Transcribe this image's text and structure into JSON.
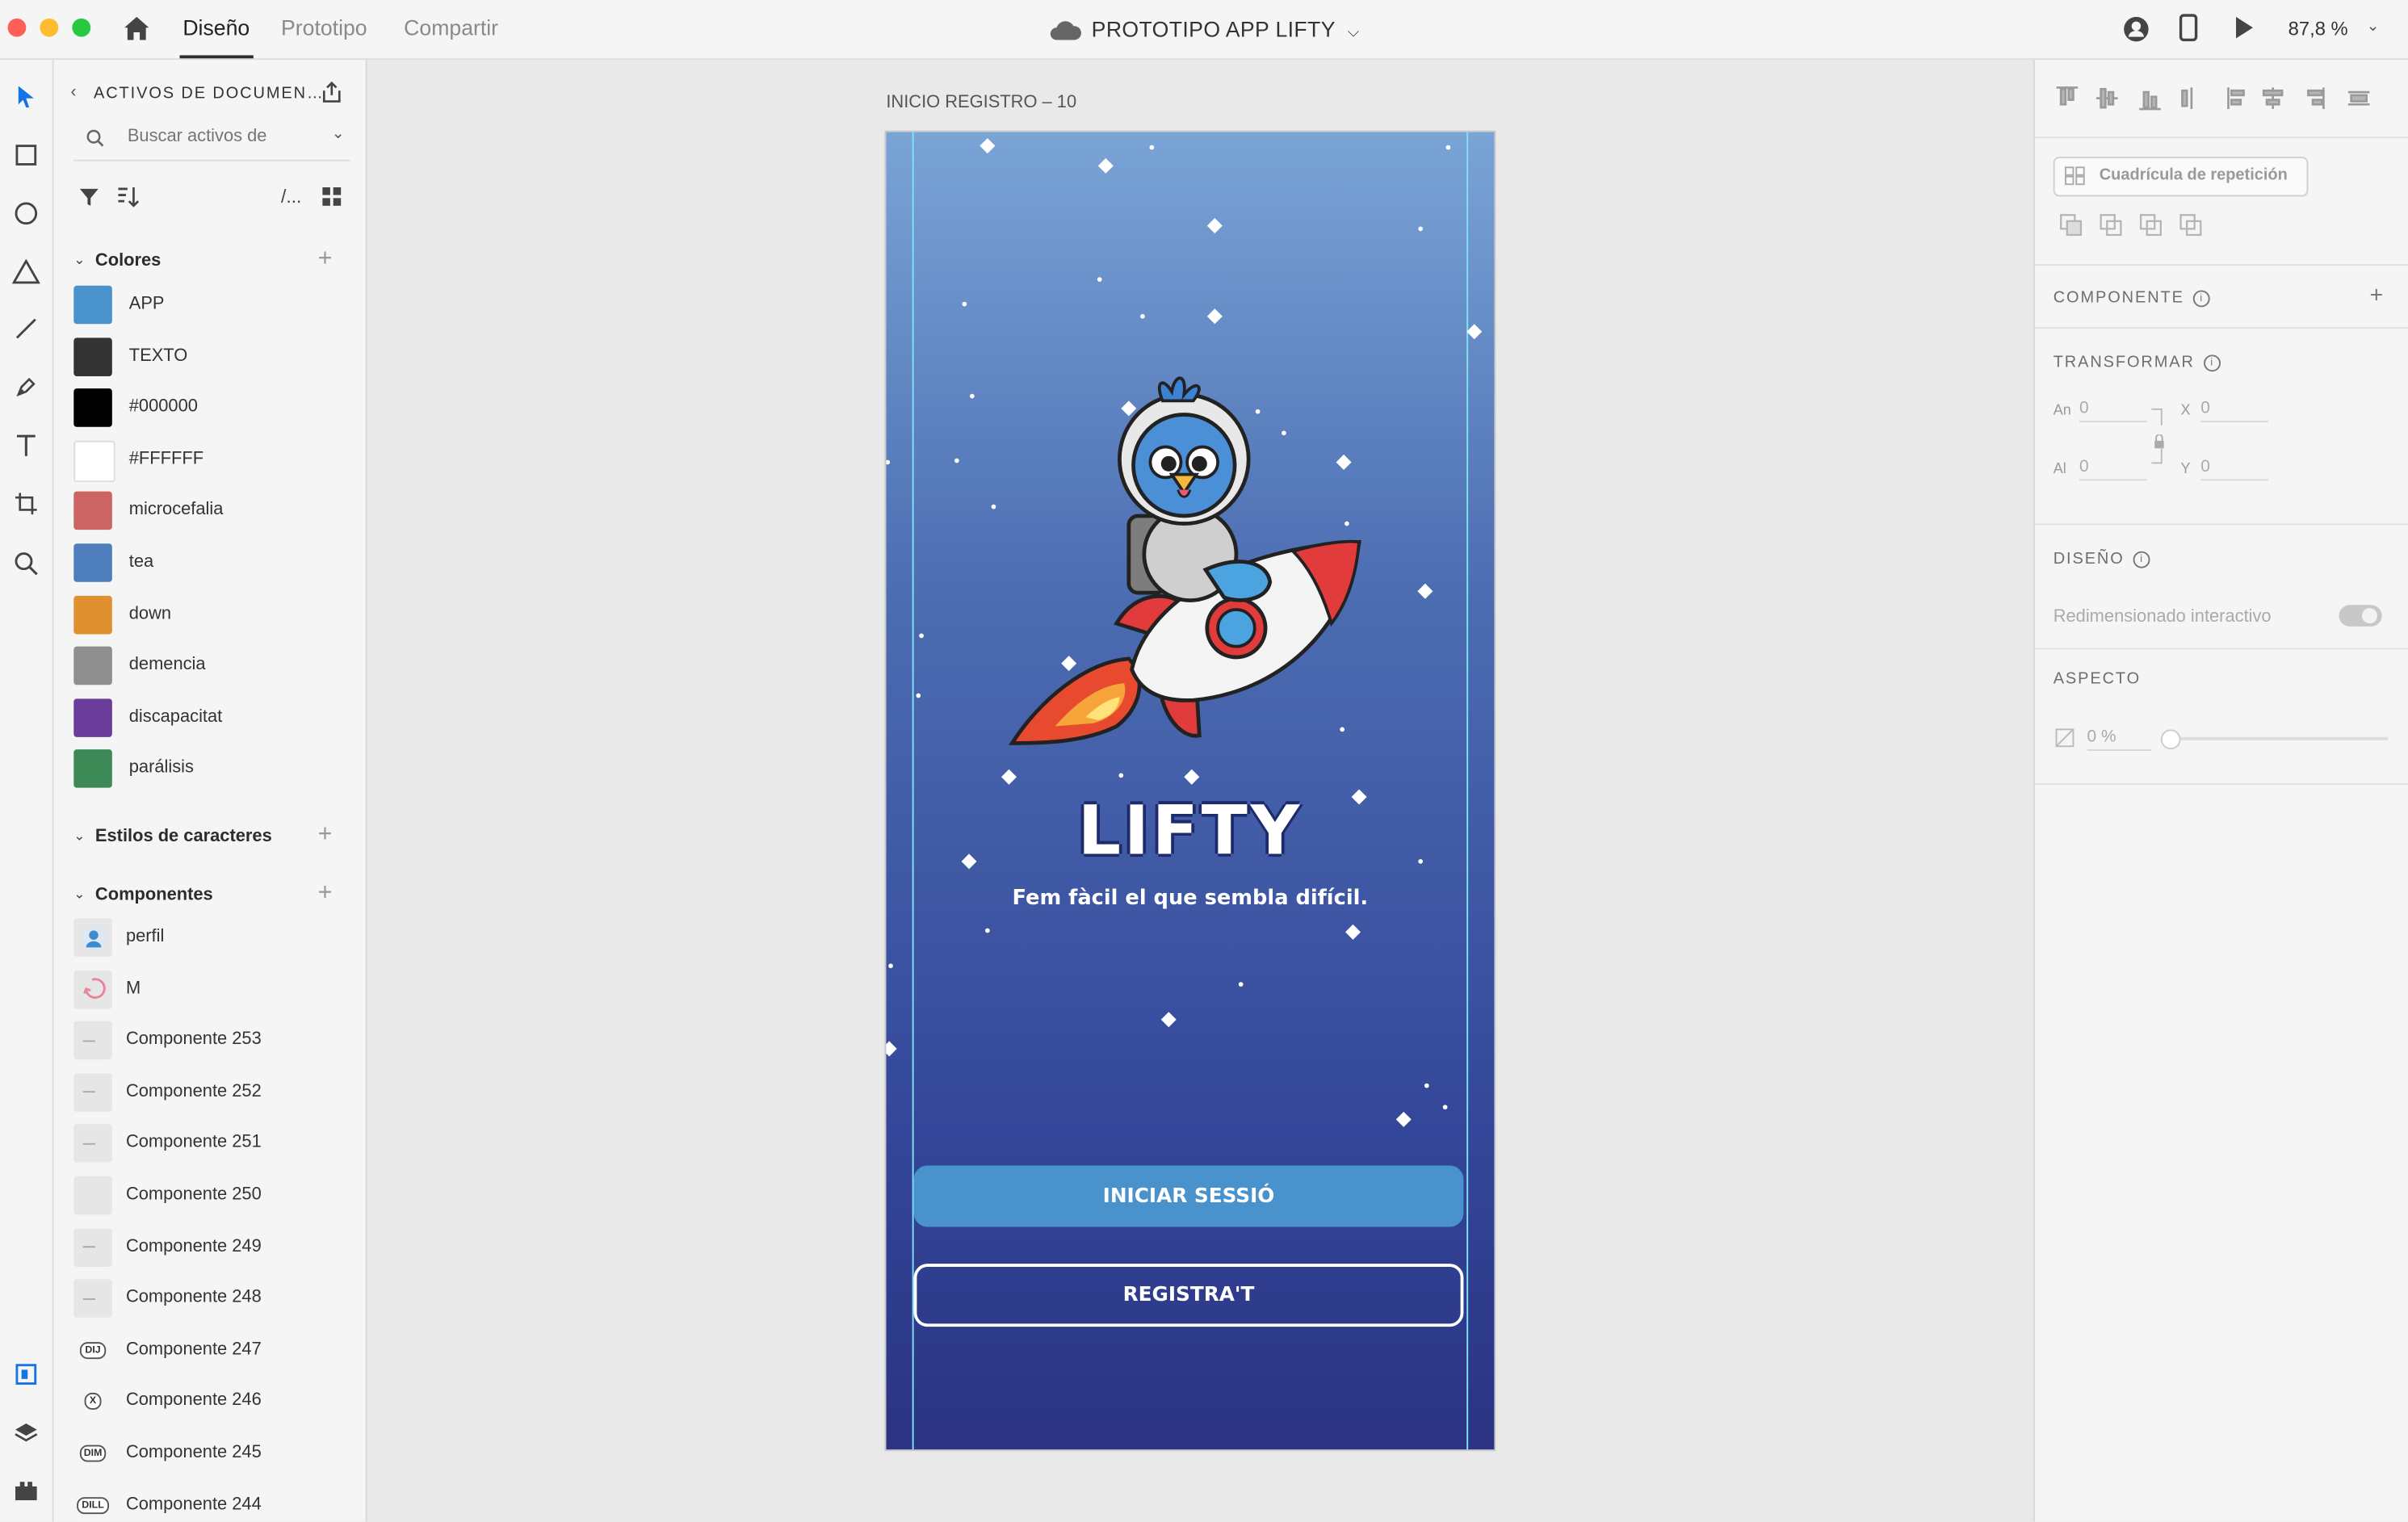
{
  "window": {
    "tabs": [
      "Diseño",
      "Prototipo",
      "Compartir"
    ],
    "active_tab": "Diseño",
    "document_title": "PROTOTIPO APP LIFTY",
    "zoom": "87,8 %"
  },
  "assets": {
    "header": "ACTIVOS DE DOCUMEN…",
    "search_placeholder": "Buscar activos de",
    "filter_path": "/...",
    "colors_title": "Colores",
    "colors": [
      {
        "label": "APP",
        "hex": "#4A92CC"
      },
      {
        "label": "TEXTO",
        "hex": "#333333"
      },
      {
        "label": "#000000",
        "hex": "#000000"
      },
      {
        "label": "#FFFFFF",
        "hex": "#FFFFFF"
      },
      {
        "label": "microcefalia",
        "hex": "#CD6464"
      },
      {
        "label": "tea",
        "hex": "#4E7FBC"
      },
      {
        "label": "down",
        "hex": "#E0912F"
      },
      {
        "label": "demencia",
        "hex": "#8F8F8F"
      },
      {
        "label": "discapacitat",
        "hex": "#6A3D9A"
      },
      {
        "label": "parálisis",
        "hex": "#3E8A57"
      }
    ],
    "char_styles_title": "Estilos de caracteres",
    "components_title": "Componentes",
    "components": [
      {
        "label": "perfil",
        "thumb": "avatar-icon"
      },
      {
        "label": "M",
        "thumb": "refresh-icon"
      },
      {
        "label": "Componente 253",
        "thumb": "line"
      },
      {
        "label": "Componente 252",
        "thumb": "line"
      },
      {
        "label": "Componente 251",
        "thumb": "line"
      },
      {
        "label": "Componente 250",
        "thumb": "blank"
      },
      {
        "label": "Componente 249",
        "thumb": "line"
      },
      {
        "label": "Componente 248",
        "thumb": "line"
      },
      {
        "label": "Componente 247",
        "thumb": "DIJ"
      },
      {
        "label": "Componente 246",
        "thumb": "X"
      },
      {
        "label": "Componente 245",
        "thumb": "DIM"
      },
      {
        "label": "Componente 244",
        "thumb": "DILL"
      }
    ]
  },
  "canvas": {
    "artboard_label": "INICIO REGISTRO – 10",
    "brand": "LIFTY",
    "tagline": "Fem fàcil el que sembla difícil.",
    "login_button": "INICIAR SESSIÓ",
    "register_button": "REGISTRA'T"
  },
  "properties": {
    "repeat_grid": "Cuadrícula de repetición",
    "component_title": "COMPONENTE",
    "transform_title": "TRANSFORMAR",
    "w_label": "An",
    "w_value": "0",
    "h_label": "Al",
    "h_value": "0",
    "x_label": "X",
    "x_value": "0",
    "y_label": "Y",
    "y_value": "0",
    "layout_title": "DISEÑO",
    "responsive_resize": "Redimensionado interactivo",
    "appearance_title": "ASPECTO",
    "opacity": "0 %"
  }
}
